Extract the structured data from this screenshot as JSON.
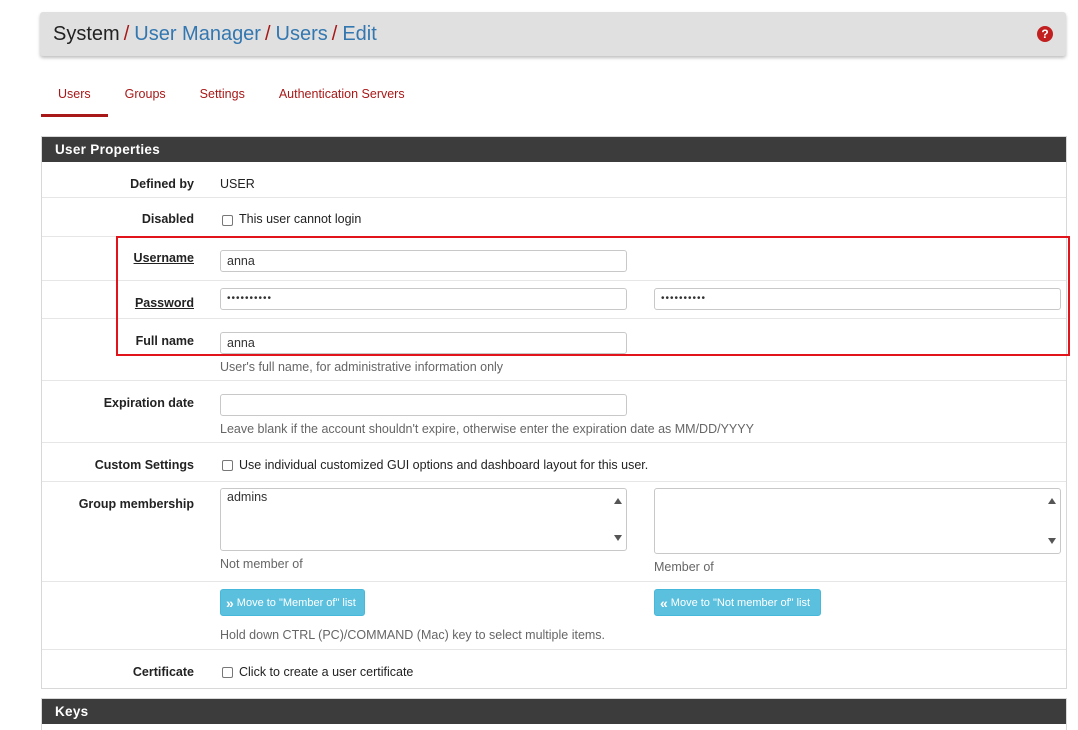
{
  "breadcrumb": {
    "root": "System",
    "separator": "/",
    "items": [
      "User Manager",
      "Users",
      "Edit"
    ]
  },
  "help_icon": "question-circle-icon",
  "tabs": [
    {
      "label": "Users",
      "active": true
    },
    {
      "label": "Groups",
      "active": false
    },
    {
      "label": "Settings",
      "active": false
    },
    {
      "label": "Authentication Servers",
      "active": false
    }
  ],
  "user_properties": {
    "title": "User Properties",
    "defined_by": {
      "label": "Defined by",
      "value": "USER"
    },
    "disabled": {
      "label": "Disabled",
      "checkbox_label": "This user cannot login",
      "checked": false
    },
    "username": {
      "label": "Username",
      "value": "anna"
    },
    "password": {
      "label": "Password",
      "value": "••••••••••",
      "confirm_value": "••••••••••"
    },
    "full_name": {
      "label": "Full name",
      "value": "anna",
      "help": "User's full name, for administrative information only"
    },
    "expiration": {
      "label": "Expiration date",
      "value": "",
      "help": "Leave blank if the account shouldn't expire, otherwise enter the expiration date as MM/DD/YYYY"
    },
    "custom_settings": {
      "label": "Custom Settings",
      "checkbox_label": "Use individual customized GUI options and dashboard layout for this user.",
      "checked": false
    },
    "group_membership": {
      "label": "Group membership",
      "not_member_options": [
        "admins"
      ],
      "member_options": [],
      "not_member_caption": "Not member of",
      "member_caption": "Member of"
    },
    "move_buttons": {
      "to_member": "Move to \"Member of\" list",
      "to_not_member": "Move to \"Not member of\" list",
      "help": "Hold down CTRL (PC)/COMMAND (Mac) key to select multiple items."
    },
    "certificate": {
      "label": "Certificate",
      "checkbox_label": "Click to create a user certificate",
      "checked": false
    }
  },
  "keys": {
    "title": "Keys"
  },
  "colors": {
    "accent": "#a81818",
    "link": "#3377b0",
    "panel_head": "#3c3c3c",
    "info_button": "#5bc0de",
    "highlight": "#e0141a"
  }
}
